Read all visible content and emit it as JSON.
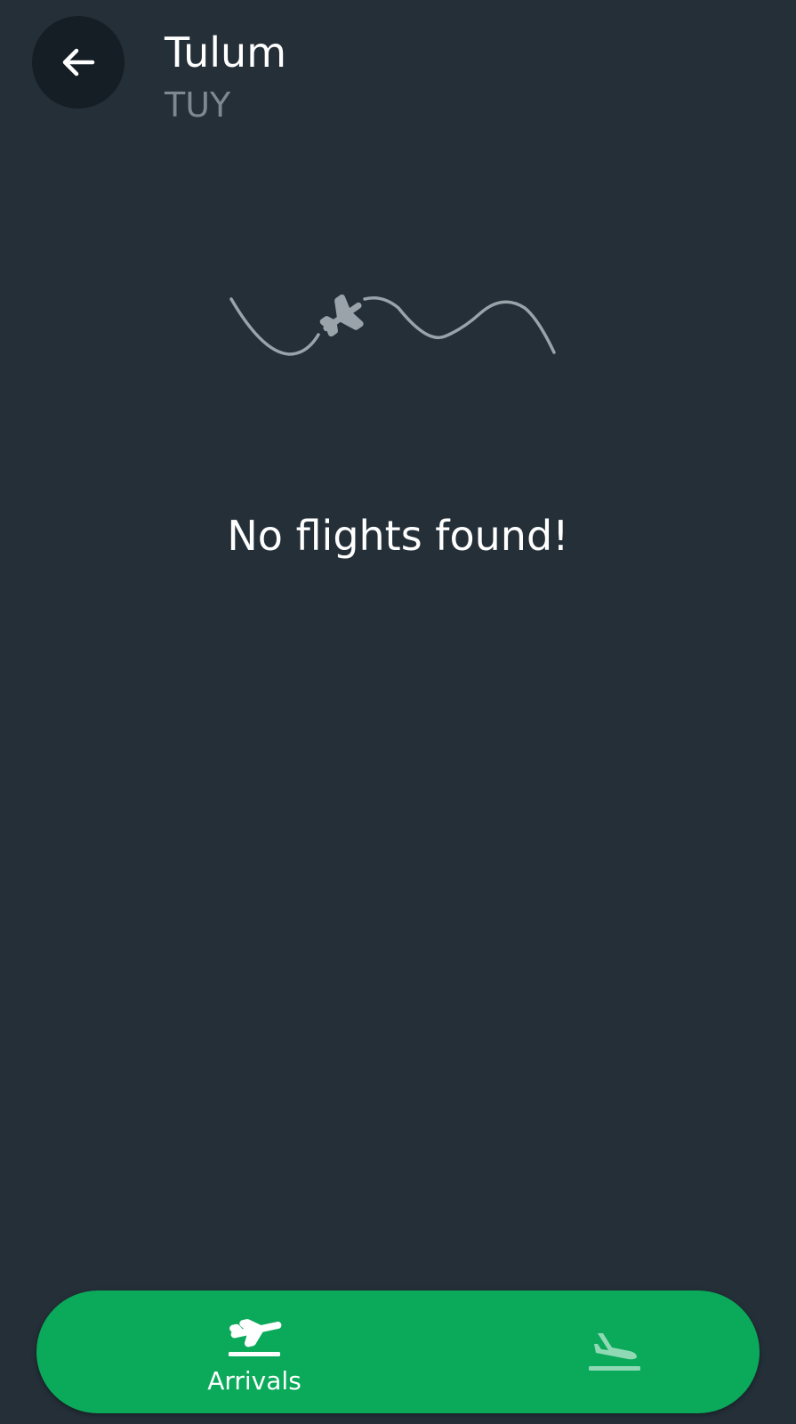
{
  "header": {
    "back_icon": "arrow-left-icon",
    "title": "Tulum",
    "subtitle": "TUY"
  },
  "empty_state": {
    "icon": "airplane-flight-path-icon",
    "message": "No flights found!"
  },
  "bottom_nav": {
    "tabs": [
      {
        "label": "Arrivals",
        "icon": "flight-takeoff-icon",
        "active": true
      },
      {
        "label": "",
        "icon": "flight-land-icon",
        "active": false
      }
    ]
  },
  "colors": {
    "background": "#242f38",
    "back_button_bg": "#151e25",
    "accent_green": "#0aaa5a",
    "subtitle_gray": "#7d8990",
    "illustration_gray": "#9aa3a9"
  }
}
